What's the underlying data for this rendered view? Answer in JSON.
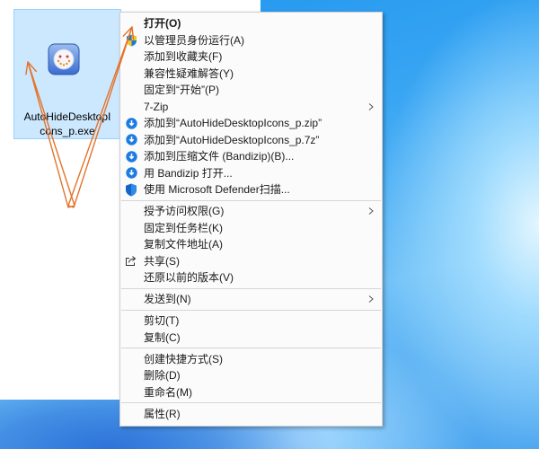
{
  "desktop": {
    "file_item": {
      "name_lines": [
        "AutoHideDesktopI",
        "cons_p.exe"
      ],
      "icon": "app-icon"
    }
  },
  "context_menu": {
    "items": [
      {
        "label": "打开(O)"
      },
      {
        "label": "以管理员身份运行(A)",
        "icon": "uac-shield-icon"
      },
      {
        "label": "添加到收藏夹(F)"
      },
      {
        "label": "兼容性疑难解答(Y)"
      },
      {
        "label": "固定到“开始”(P)"
      },
      {
        "label": "7-Zip",
        "submenu": true
      },
      {
        "label": "添加到“AutoHideDesktopIcons_p.zip”",
        "icon": "bandizip-icon"
      },
      {
        "label": "添加到“AutoHideDesktopIcons_p.7z”",
        "icon": "bandizip-icon"
      },
      {
        "label": "添加到压缩文件 (Bandizip)(B)...",
        "icon": "bandizip-icon"
      },
      {
        "label": "用 Bandizip 打开...",
        "icon": "bandizip-icon"
      },
      {
        "label": "使用 Microsoft Defender扫描...",
        "icon": "defender-shield-icon"
      },
      {
        "label": "授予访问权限(G)",
        "submenu": true
      },
      {
        "label": "固定到任务栏(K)"
      },
      {
        "label": "复制文件地址(A)"
      },
      {
        "label": "共享(S)",
        "icon": "share-icon"
      },
      {
        "label": "还原以前的版本(V)"
      },
      {
        "label": "发送到(N)",
        "submenu": true
      },
      {
        "label": "剪切(T)"
      },
      {
        "label": "复制(C)"
      },
      {
        "label": "创建快捷方式(S)"
      },
      {
        "label": "删除(D)"
      },
      {
        "label": "重命名(M)"
      },
      {
        "label": "属性(R)"
      }
    ]
  },
  "colors": {
    "selection_background": "#cce8ff",
    "selection_border": "#99d1ff",
    "annotation_arrow": "#e2742b"
  }
}
